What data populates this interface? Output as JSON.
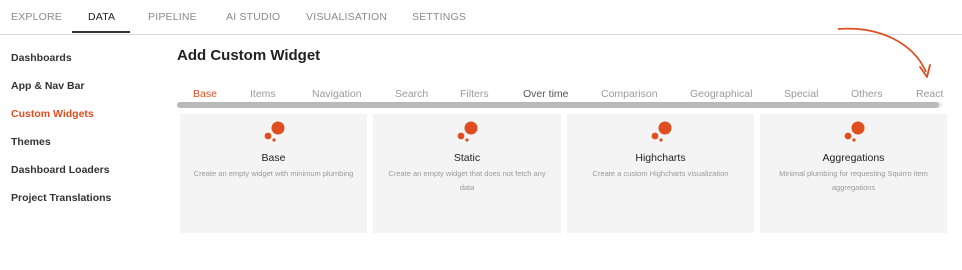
{
  "topnav": {
    "tabs": [
      "EXPLORE",
      "DATA",
      "PIPELINE",
      "AI STUDIO",
      "VISUALISATION",
      "SETTINGS"
    ],
    "active": "DATA"
  },
  "sidebar": {
    "items": [
      "Dashboards",
      "App & Nav Bar",
      "Custom Widgets",
      "Themes",
      "Dashboard Loaders",
      "Project Translations"
    ],
    "active": "Custom Widgets"
  },
  "main": {
    "title": "Add Custom Widget",
    "categories": [
      "Base",
      "Items",
      "Navigation",
      "Search",
      "Filters",
      "Over time",
      "Comparison",
      "Geographical",
      "Special",
      "Others",
      "React"
    ],
    "active_category": "Base",
    "cards": [
      {
        "name": "Base",
        "description": "Create an empty widget with minimum plumbing",
        "icon": "squirro-logo-icon"
      },
      {
        "name": "Static",
        "description": "Create an empty widget that does not fetch any data",
        "icon": "squirro-logo-icon"
      },
      {
        "name": "Highcharts",
        "description": "Create a custom Highcharts visualization",
        "icon": "squirro-logo-icon"
      },
      {
        "name": "Aggregations",
        "description": "Minimal plumbing for requesting Squirro item aggregations",
        "icon": "squirro-logo-icon"
      }
    ]
  },
  "colors": {
    "accent": "#e04d1f",
    "card_bg": "#f4f4f4",
    "annotation_arrow": "#e04d1f"
  }
}
